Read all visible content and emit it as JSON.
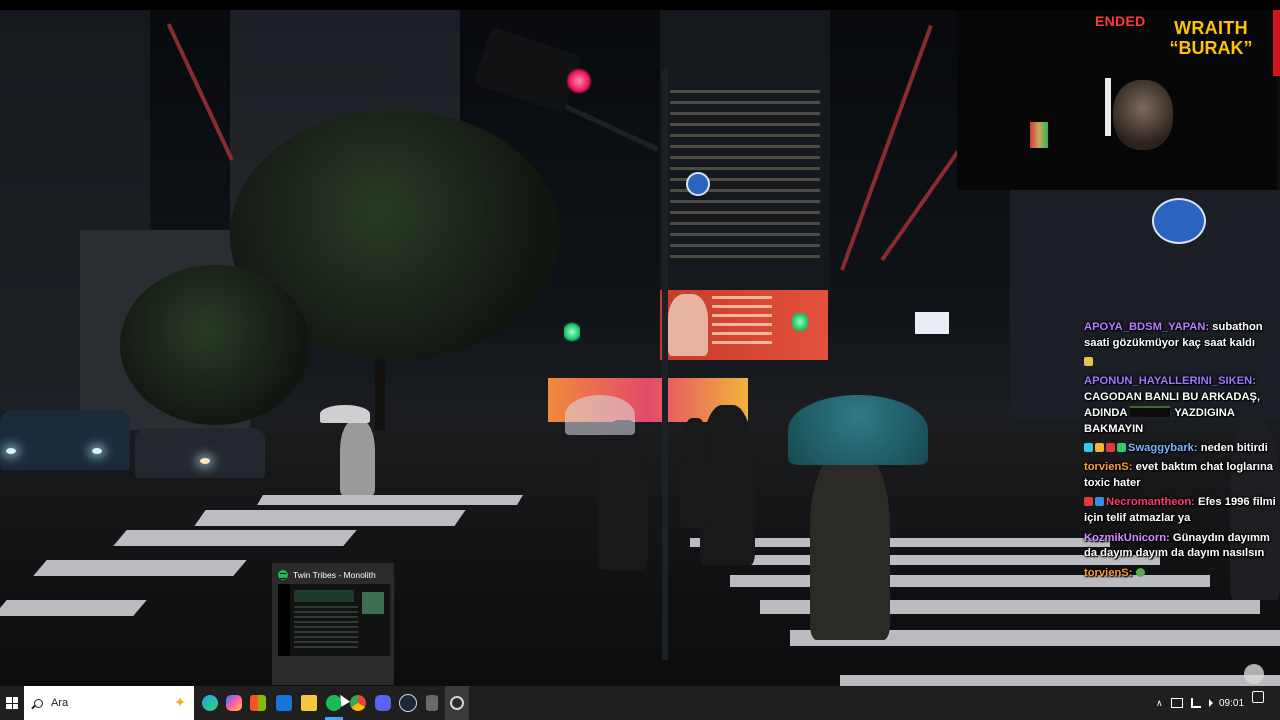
{
  "overlay": {
    "status_label": "ENDED",
    "streamer_logo": {
      "line1": "WRAITH",
      "line2": "“BURAK”"
    }
  },
  "chat": {
    "messages": [
      {
        "user": "APOYA_BDSM_YAPAN:",
        "user_color": "#b97cff",
        "text": " subathon saati gözükmüyor kaç saat kaldı",
        "badges": []
      },
      {
        "user": "",
        "user_color": "#ffffff",
        "text": "",
        "badges": [
          "gift-emote"
        ]
      },
      {
        "user": "APONUN_HAYALLERINI_SIKEN:",
        "user_color": "#9a7bff",
        "text": " CAGODAN BANLI BU ARKADAŞ, ADINDA",
        "text_after_redaction": " YAZDIGINA BAKMAYIN",
        "badges": []
      },
      {
        "user": "Swaggybark:",
        "user_color": "#7fb4ff",
        "text": " neden bitirdi",
        "badges": [
          "sword-badge",
          "crown-badge",
          "red-badge",
          "clover-badge"
        ]
      },
      {
        "user": "torvienS:",
        "user_color": "#ff9c3a",
        "text": " evet baktım chat loglarına toxic hater",
        "badges": []
      },
      {
        "user": "Necromantheon:",
        "user_color": "#ff3b6b",
        "text": " Efes 1996 filmi için telif atmazlar ya",
        "badges": [
          "red-badge",
          "blue-badge"
        ]
      },
      {
        "user": "KozmikUnicorn:",
        "user_color": "#d98cff",
        "text": " Günaydın dayımm da dayım dayım da dayım nasılsın",
        "badges": []
      },
      {
        "user": "torvienS:",
        "user_color": "#ff9c3a",
        "text": " ",
        "badges": [
          "frog-emote"
        ]
      }
    ]
  },
  "spotify_preview": {
    "icon": "spotify-icon",
    "title": "Twin Tribes - Monolith"
  },
  "taskbar": {
    "search_placeholder": "Ara",
    "pinned": [
      "windows-start-icon",
      "edge-icon",
      "copilot-icon",
      "store-icon",
      "outlook-icon",
      "file-explorer-icon",
      "spotify-icon",
      "chrome-icon",
      "discord-icon",
      "steam-icon",
      "audio-app-icon",
      "obs-icon"
    ],
    "active_app": "spotify-icon",
    "clock": "09:01",
    "accent_color": "#4aa3ff"
  }
}
